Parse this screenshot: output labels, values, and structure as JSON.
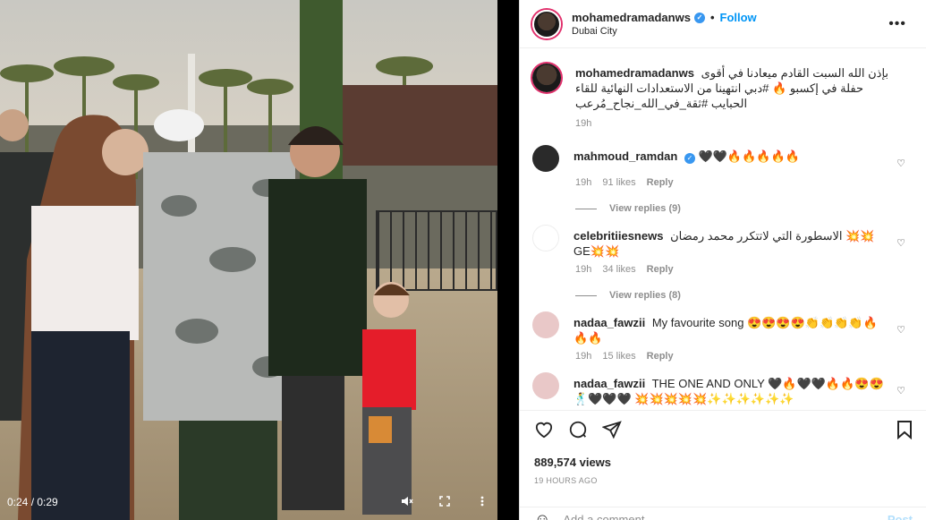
{
  "video": {
    "time": "0:24 / 0:29",
    "mute_icon": "muted-speaker-icon",
    "fullscreen_icon": "fullscreen-icon",
    "menu_icon": "vertical-dots-icon"
  },
  "header": {
    "username": "mohamedramadanws",
    "follow_label": "Follow",
    "dot": "•",
    "location": "Dubai City",
    "more_label": "•••"
  },
  "caption": {
    "username": "mohamedramadanws",
    "text": "بإذن الله السبت القادم ميعادنا في أقوى حفلة في إكسبو 🔥 #دبي انتهينا من الاستعدادات النهائية للقاء الحبايب #ثقة_في_الله_نجاح_مُرعب",
    "time": "19h"
  },
  "comments": [
    {
      "username": "mahmoud_ramdan",
      "verified": true,
      "text": "🖤🖤🔥🔥🔥🔥🔥",
      "time": "19h",
      "likes": "91 likes",
      "reply": "Reply",
      "view_replies": "View replies (9)"
    },
    {
      "username": "celebritiiesnews",
      "verified": false,
      "text": "الاسطورة التي لاتتكرر محمد رمضان 💥💥GE💥💥",
      "time": "19h",
      "likes": "34 likes",
      "reply": "Reply",
      "view_replies": "View replies (8)"
    },
    {
      "username": "nadaa_fawzii",
      "verified": false,
      "text": "My favourite song 😍😍😍😍👏👏👏👏🔥🔥🔥",
      "time": "19h",
      "likes": "15 likes",
      "reply": "Reply"
    },
    {
      "username": "nadaa_fawzii",
      "verified": false,
      "text": "THE ONE AND ONLY 🖤🔥🖤🖤🔥🔥😍😍🕺🖤🖤🖤 💥💥💥💥💥✨✨✨✨✨✨"
    }
  ],
  "actions": {
    "like_icon": "heart-icon",
    "comment_icon": "comment-icon",
    "share_icon": "send-icon",
    "save_icon": "bookmark-icon",
    "views": "889,574 views",
    "ago": "19 HOURS AGO"
  },
  "add_comment": {
    "placeholder": "Add a comment...",
    "post_label": "Post",
    "emoji_icon": "smiley-icon"
  },
  "colors": {
    "link": "#0095f6",
    "muted": "#8e8e8e",
    "text": "#262626"
  }
}
